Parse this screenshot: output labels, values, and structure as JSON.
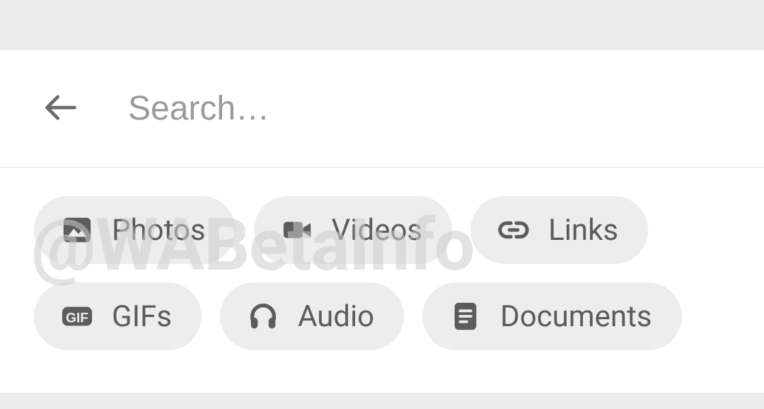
{
  "search": {
    "placeholder": "Search…",
    "value": ""
  },
  "chips": {
    "photos": "Photos",
    "videos": "Videos",
    "links": "Links",
    "gifs": "GIFs",
    "audio": "Audio",
    "documents": "Documents"
  },
  "watermark": "@WABetaInfo"
}
